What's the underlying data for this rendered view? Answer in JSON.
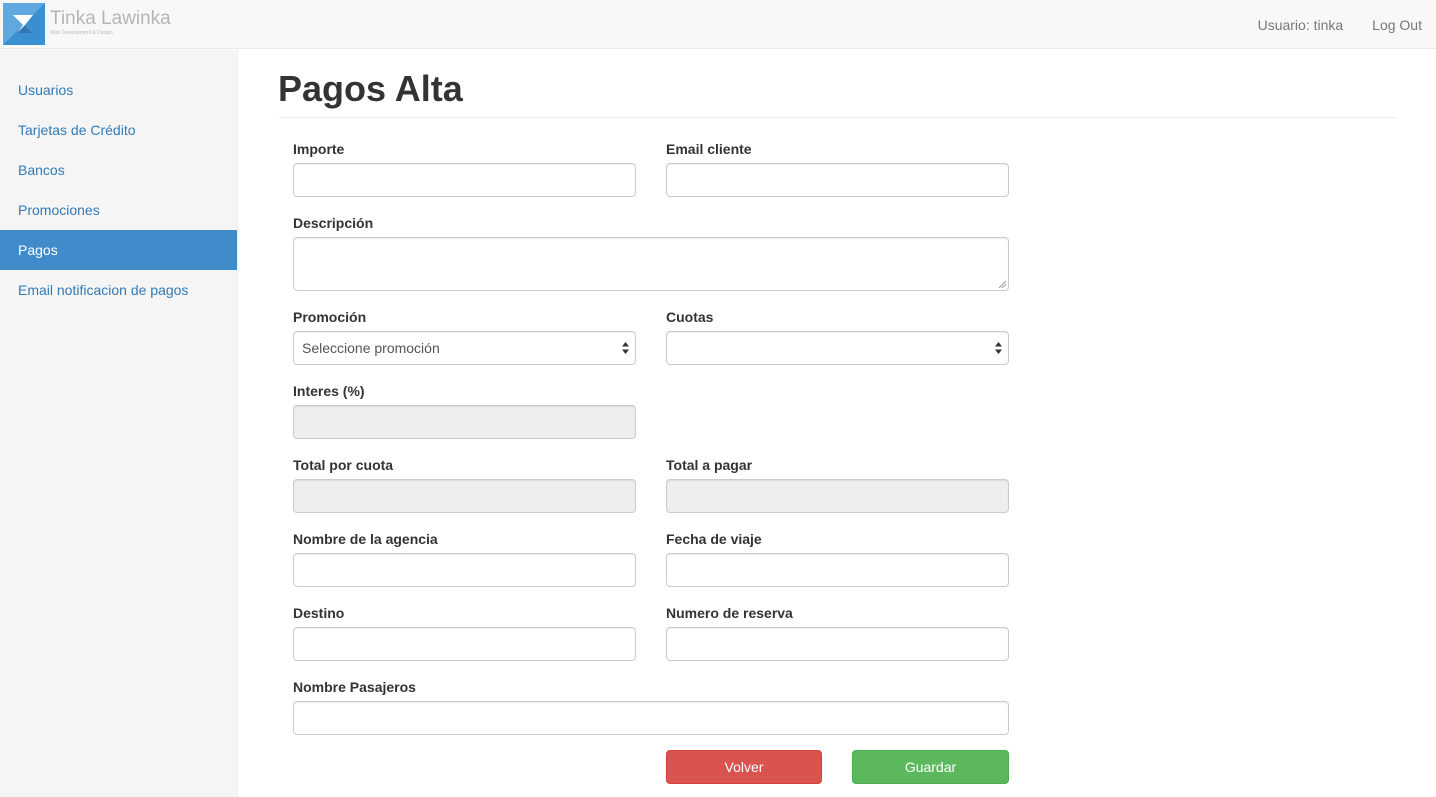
{
  "brand": {
    "title": "Tinka Lawinka",
    "tagline": "Web Development & Design"
  },
  "nav": {
    "user": "Usuario: tinka",
    "logout": "Log Out"
  },
  "sidebar": {
    "items": [
      {
        "label": "Usuarios"
      },
      {
        "label": "Tarjetas de Crédito"
      },
      {
        "label": "Bancos"
      },
      {
        "label": "Promociones"
      },
      {
        "label": "Pagos",
        "active": true
      },
      {
        "label": "Email notificacion de pagos"
      }
    ]
  },
  "page": {
    "title": "Pagos Alta"
  },
  "form": {
    "importe": {
      "label": "Importe",
      "value": ""
    },
    "email_cliente": {
      "label": "Email cliente",
      "value": ""
    },
    "descripcion": {
      "label": "Descripción",
      "value": ""
    },
    "promocion": {
      "label": "Promoción",
      "selected": "Seleccione promoción"
    },
    "cuotas": {
      "label": "Cuotas",
      "selected": ""
    },
    "interes": {
      "label": "Interes (%)",
      "value": ""
    },
    "total_por_cuota": {
      "label": "Total por cuota",
      "value": ""
    },
    "total_a_pagar": {
      "label": "Total a pagar",
      "value": ""
    },
    "nombre_agencia": {
      "label": "Nombre de la agencia",
      "value": ""
    },
    "fecha_viaje": {
      "label": "Fecha de viaje",
      "value": ""
    },
    "destino": {
      "label": "Destino",
      "value": ""
    },
    "numero_reserva": {
      "label": "Numero de reserva",
      "value": ""
    },
    "nombre_pasajeros": {
      "label": "Nombre Pasajeros",
      "value": ""
    }
  },
  "buttons": {
    "volver": "Volver",
    "guardar": "Guardar"
  },
  "colors": {
    "primary": "#428bca",
    "link": "#337ab7",
    "danger": "#d9534f",
    "success": "#5cb85c"
  }
}
